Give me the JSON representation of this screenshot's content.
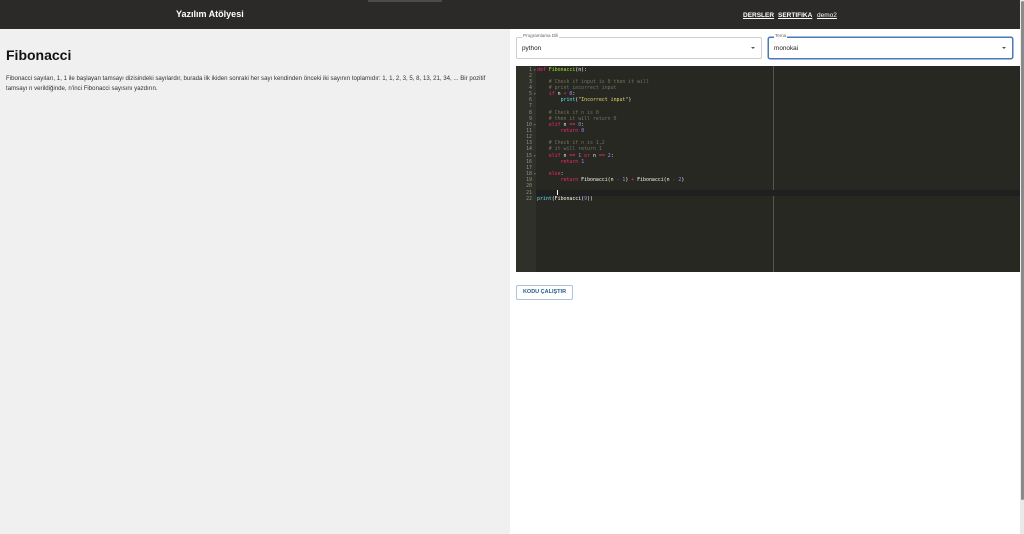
{
  "header": {
    "brand": "Yazılım Atölyesi",
    "nav": [
      {
        "label": "DERSLER"
      },
      {
        "label": "SERTIFIKA"
      },
      {
        "label": "demo2"
      }
    ]
  },
  "problem": {
    "title": "Fibonacci",
    "description": "Fibonacci sayıları, 1, 1 ile başlayan tamsayı dizisindeki sayılardır, burada ilk ikiden sonraki her sayı kendinden önceki iki sayının toplamıdır: 1, 1, 2, 3, 5, 8, 13, 21, 34, ... Bir pozitif tamsayı n verildiğinde, n'inci Fibonacci sayısını yazdırın."
  },
  "controls": {
    "language_label": "Programlama Dili",
    "language_value": "python",
    "theme_label": "Tema",
    "theme_value": "monokai",
    "run_label": "KODU ÇALIŞTIR"
  },
  "editor": {
    "line_numbers": [
      "1",
      "2",
      "3",
      "4",
      "5",
      "6",
      "7",
      "8",
      "9",
      "10",
      "11",
      "12",
      "13",
      "14",
      "15",
      "16",
      "17",
      "18",
      "19",
      "20",
      "21",
      "22"
    ],
    "code": [
      [
        [
          "kw",
          "def "
        ],
        [
          "fn",
          "Fibonacci"
        ],
        [
          "",
          "(n):"
        ]
      ],
      [],
      [
        [
          "",
          "    "
        ],
        [
          "cm",
          "# Check if input is 0 then it will"
        ]
      ],
      [
        [
          "",
          "    "
        ],
        [
          "cm",
          "# print incorrect input"
        ]
      ],
      [
        [
          "",
          "    "
        ],
        [
          "kw",
          "if"
        ],
        [
          "",
          " n "
        ],
        [
          "kw",
          "<"
        ],
        [
          "",
          " "
        ],
        [
          "num",
          "0"
        ],
        [
          "",
          ":"
        ]
      ],
      [
        [
          "",
          "        "
        ],
        [
          "bi",
          "print"
        ],
        [
          "",
          "("
        ],
        [
          "str",
          "\"Incorrect input\""
        ],
        [
          "",
          ")"
        ]
      ],
      [],
      [
        [
          "",
          "    "
        ],
        [
          "cm",
          "# Check if n is 0"
        ]
      ],
      [
        [
          "",
          "    "
        ],
        [
          "cm",
          "# then it will return 0"
        ]
      ],
      [
        [
          "",
          "    "
        ],
        [
          "kw",
          "elif"
        ],
        [
          "",
          " n "
        ],
        [
          "kw",
          "=="
        ],
        [
          "",
          " "
        ],
        [
          "num",
          "0"
        ],
        [
          "",
          ":"
        ]
      ],
      [
        [
          "",
          "        "
        ],
        [
          "kw",
          "return"
        ],
        [
          "",
          " "
        ],
        [
          "num",
          "0"
        ]
      ],
      [],
      [
        [
          "",
          "    "
        ],
        [
          "cm",
          "# Check if n is 1,2"
        ]
      ],
      [
        [
          "",
          "    "
        ],
        [
          "cm",
          "# it will return 1"
        ]
      ],
      [
        [
          "",
          "    "
        ],
        [
          "kw",
          "elif"
        ],
        [
          "",
          " n "
        ],
        [
          "kw",
          "=="
        ],
        [
          "",
          " "
        ],
        [
          "num",
          "1"
        ],
        [
          "",
          " "
        ],
        [
          "kw",
          "or"
        ],
        [
          "",
          " n "
        ],
        [
          "kw",
          "=="
        ],
        [
          "",
          " "
        ],
        [
          "num",
          "2"
        ],
        [
          "",
          ":"
        ]
      ],
      [
        [
          "",
          "        "
        ],
        [
          "kw",
          "return"
        ],
        [
          "",
          " "
        ],
        [
          "num",
          "1"
        ]
      ],
      [],
      [
        [
          "",
          "    "
        ],
        [
          "kw",
          "else"
        ],
        [
          "",
          ":"
        ]
      ],
      [
        [
          "",
          "        "
        ],
        [
          "kw",
          "return"
        ],
        [
          "",
          " Fibonacci(n "
        ],
        [
          "kw",
          "-"
        ],
        [
          "",
          " "
        ],
        [
          "num",
          "1"
        ],
        [
          "",
          ") "
        ],
        [
          "kw",
          "+"
        ],
        [
          "",
          " Fibonacci(n "
        ],
        [
          "kw",
          "-"
        ],
        [
          "",
          " "
        ],
        [
          "num",
          "2"
        ],
        [
          "",
          ")"
        ]
      ],
      [],
      [],
      [
        [
          "bi",
          "print"
        ],
        [
          "",
          "(Fibonacci("
        ],
        [
          "num",
          "9"
        ],
        [
          "",
          "))"
        ]
      ]
    ],
    "fold_lines": [
      "1",
      "5",
      "10",
      "15",
      "18"
    ],
    "active_line": 21
  }
}
